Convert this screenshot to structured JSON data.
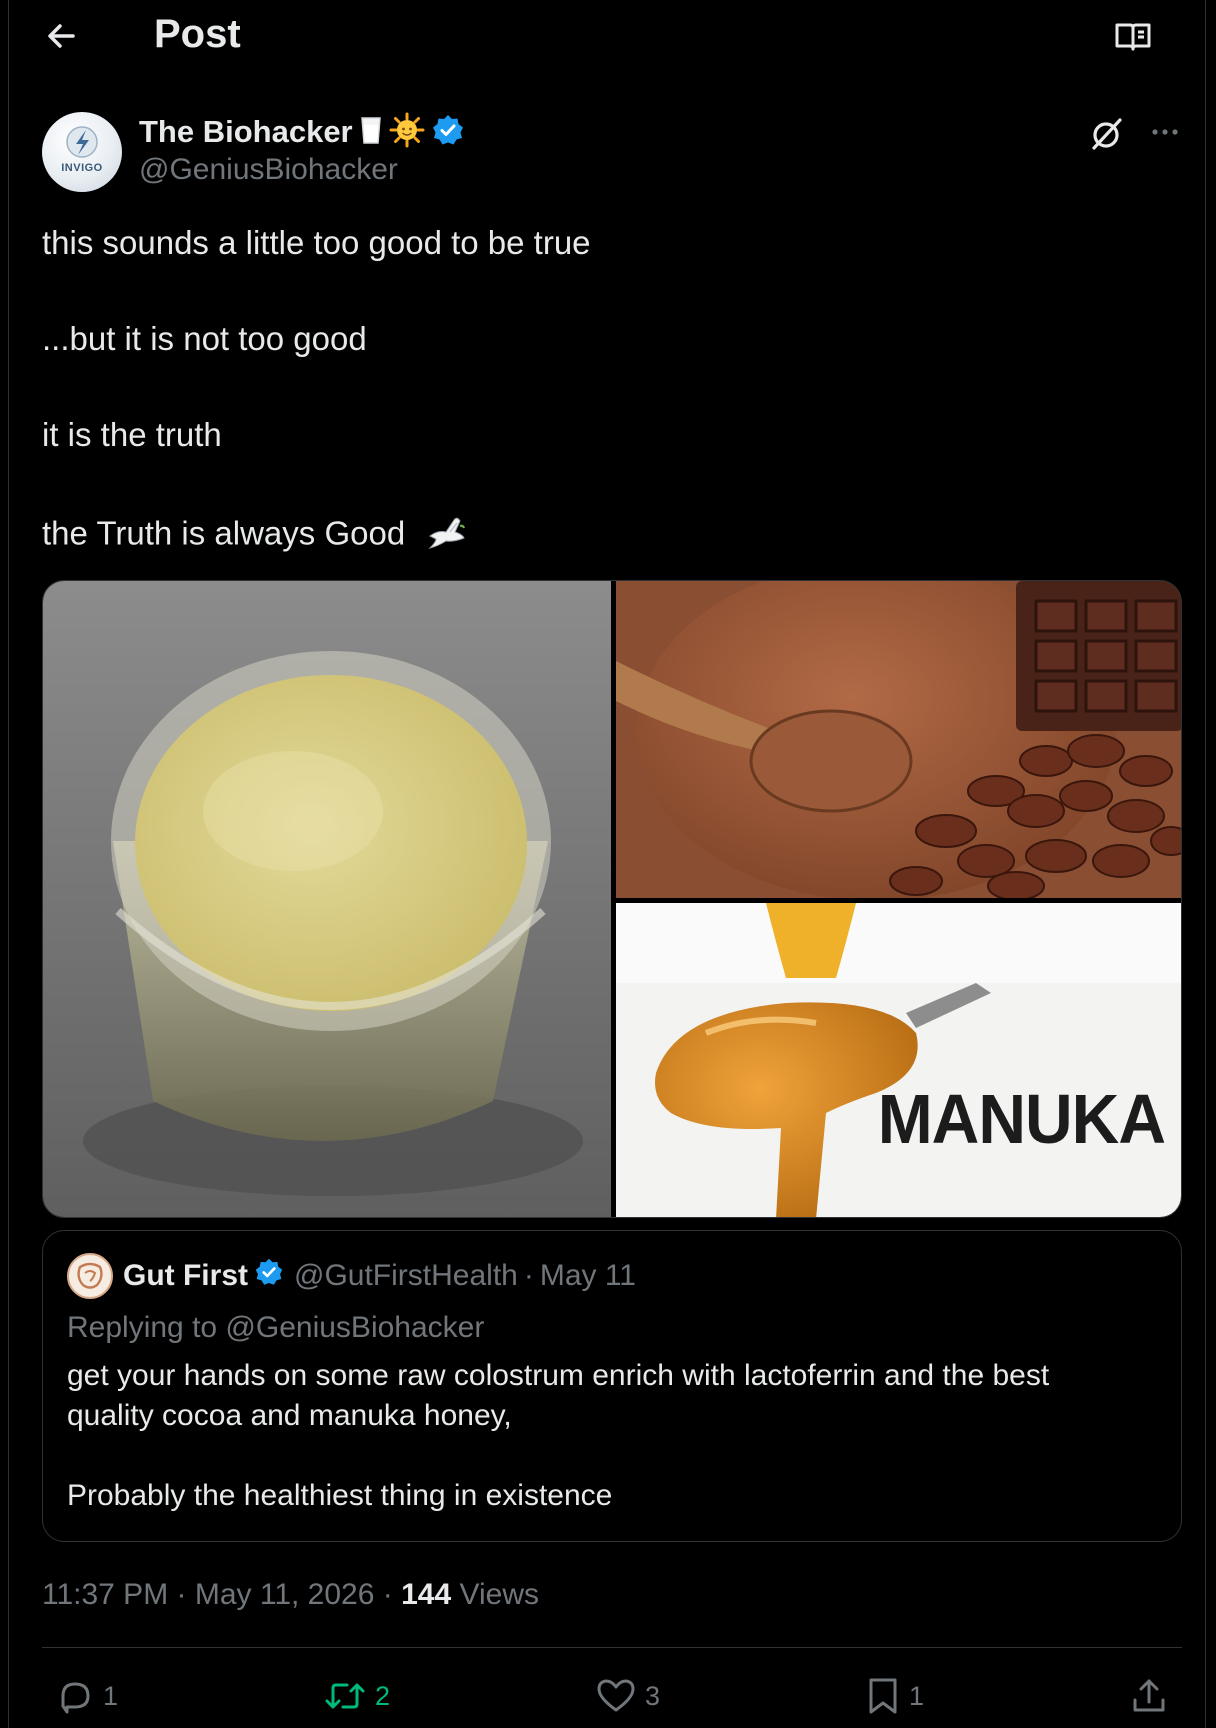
{
  "header": {
    "title": "Post"
  },
  "author": {
    "name": "The Biohacker",
    "handle": "@GeniusBiohacker",
    "avatar_brand": "INVIGO",
    "emojis": [
      "milk-glass-icon",
      "sun-icon"
    ],
    "verified_color": "#1d9bf0"
  },
  "post": {
    "paragraphs": [
      "this sounds a little too good to be true",
      "...but it is not too good",
      "it is the truth",
      "the Truth is always Good"
    ],
    "dove_icon": "dove-icon"
  },
  "media": {
    "images": [
      "colostrum-cup-image",
      "cocoa-powder-image",
      "manuka-honey-image"
    ],
    "manuka_label": "MANUKA"
  },
  "quote": {
    "name": "Gut First",
    "handle": "@GutFirstHealth",
    "separator": "·",
    "date": "May 11",
    "replying_to": "Replying to @GeniusBiohacker",
    "lines": [
      "get your hands on some raw colostrum enrich with lactoferrin and the best",
      "quality cocoa and manuka honey,",
      "Probably the healthiest thing in existence"
    ]
  },
  "meta": {
    "time": "11:37 PM",
    "date": "May 11, 2026",
    "views_count": "144",
    "views_label": "Views"
  },
  "actions": {
    "reply_count": "1",
    "repost_count": "2",
    "like_count": "3",
    "bookmark_count": "1",
    "repost_color": "#00ba7c",
    "icon_color": "#71767b"
  }
}
